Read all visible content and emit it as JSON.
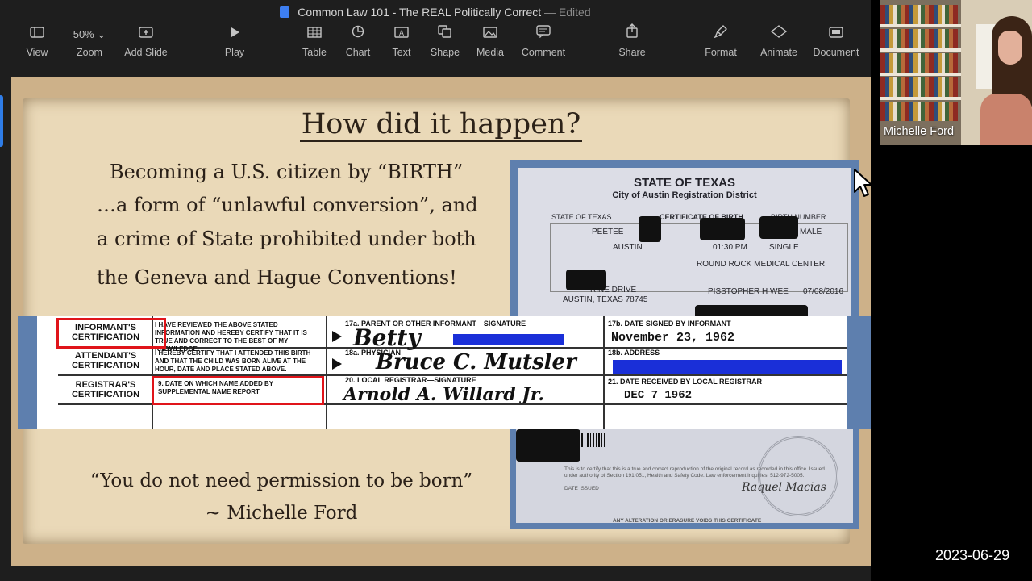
{
  "window": {
    "title": "Common Law 101 - The REAL Politically Correct",
    "edited_suffix": "— Edited"
  },
  "toolbar": {
    "view": "View",
    "zoom_value": "50%",
    "zoom": "Zoom",
    "add_slide": "Add Slide",
    "play": "Play",
    "table": "Table",
    "chart": "Chart",
    "text": "Text",
    "shape": "Shape",
    "media": "Media",
    "comment": "Comment",
    "share": "Share",
    "format": "Format",
    "animate": "Animate",
    "document": "Document"
  },
  "slide": {
    "title": "How did it happen?",
    "body_lines": [
      "Becoming a U.S. citizen by “BIRTH”",
      "…a form of “unlawful conversion”, and",
      "a crime of State prohibited under both",
      "the Geneva and Hague Conventions!"
    ],
    "quote": "“You do not need permission to be born”",
    "quote_author": "~ Michelle Ford"
  },
  "certificate": {
    "state": "STATE OF TEXAS",
    "city": "City of Austin Registration District",
    "header_left": "STATE OF TEXAS",
    "header_mid": "CERTIFICATE OF BIRTH",
    "header_right": "BIRTH NUMBER",
    "child_name": "PEETEE",
    "sex": "MALE",
    "place_city": "AUSTIN",
    "birth_time": "01:30 PM",
    "plurality": "SINGLE",
    "facility": "ROUND ROCK MEDICAL CENTER",
    "address_line1": "RINE DRIVE",
    "address_line2": "AUSTIN, TEXAS 78745",
    "certifier": "PISSTOPHER H WEE",
    "certified_date": "07/08/2016",
    "strip": {
      "informant_label": "INFORMANT'S CERTIFICATION",
      "informant_text": "I HAVE REVIEWED THE ABOVE STATED INFORMATION AND HEREBY CERTIFY THAT IT IS TRUE AND CORRECT TO THE BEST OF MY KNOWLEDGE.",
      "attendant_label": "ATTENDANT'S CERTIFICATION",
      "attendant_text": "I HEREBY CERTIFY THAT I ATTENDED THIS BIRTH AND THAT THE CHILD WAS BORN ALIVE AT THE HOUR, DATE AND PLACE STATED ABOVE.",
      "registrar_label": "REGISTRAR'S CERTIFICATION",
      "registrar_text": "9. DATE ON WHICH NAME ADDED BY SUPPLEMENTAL NAME REPORT",
      "field_17a": "17a. PARENT OR OTHER INFORMANT—SIGNATURE",
      "field_18a": "18a. PHYSICIAN",
      "field_20": "20. LOCAL REGISTRAR—SIGNATURE",
      "date_signed_label": "17b. DATE SIGNED BY INFORMANT",
      "date_signed": "November 23, 1962",
      "address_label": "18b. ADDRESS",
      "date_received_label": "21. DATE RECEIVED BY LOCAL REGISTRAR",
      "date_received": "DEC   7 1962",
      "sig_informant": "Betty",
      "sig_physician": "Bruce C. Mutsler",
      "sig_registrar": "Arnold A. Willard Jr."
    },
    "footer_text": "This is to certify that this is a true and correct reproduction of the original record as recorded in this office. Issued under authority of Section 191.051, Health and Safety Code. Law enforcement inquiries: 512-972-5005.",
    "date_issued_label": "DATE ISSUED",
    "registrar_signature": "Raquel Macias",
    "alteration_warning": "ANY ALTERATION OR ERASURE VOIDS THIS CERTIFICATE"
  },
  "video": {
    "participant_name": "Michelle Ford"
  },
  "timestamp": "2023-06-29",
  "colors": {
    "slide_background": "#cdb189",
    "paper": "#ead9b8",
    "certificate_border": "#5e7fae",
    "highlight_red": "#e0141a",
    "redaction_blue": "#1a2fd8"
  }
}
